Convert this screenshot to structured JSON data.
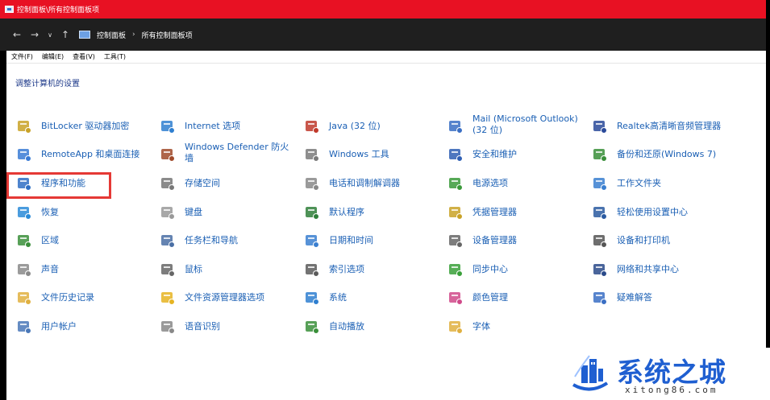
{
  "window": {
    "title": "控制面板\\所有控制面板项"
  },
  "nav": {
    "back": "←",
    "forward": "→",
    "history": "∨",
    "up": "↑",
    "breadcrumb": [
      "控制面板",
      "所有控制面板项"
    ],
    "breadcrumb_sep": "›"
  },
  "menu": [
    "文件(F)",
    "编辑(E)",
    "查看(V)",
    "工具(T)"
  ],
  "heading": "调整计算机的设置",
  "items": [
    {
      "label": "BitLocker 驱动器加密",
      "icon": "bitlocker-icon",
      "color": "#c9a227"
    },
    {
      "label": "RemoteApp 和桌面连接",
      "icon": "remoteapp-icon",
      "color": "#3a7bd5"
    },
    {
      "label": "程序和功能",
      "icon": "programs-icon",
      "color": "#2f6fc4"
    },
    {
      "label": "恢复",
      "icon": "recovery-icon",
      "color": "#2a8bd8"
    },
    {
      "label": "区域",
      "icon": "region-icon",
      "color": "#3b8f3b"
    },
    {
      "label": "声音",
      "icon": "sound-icon",
      "color": "#8a8a8a"
    },
    {
      "label": "文件历史记录",
      "icon": "file-history-icon",
      "color": "#e0b040"
    },
    {
      "label": "用户帐户",
      "icon": "user-accounts-icon",
      "color": "#4a78b8"
    },
    {
      "label": "Internet 选项",
      "icon": "internet-icon",
      "color": "#2f7fd0"
    },
    {
      "label": "Windows Defender 防火墙",
      "icon": "firewall-icon",
      "color": "#a04a2a"
    },
    {
      "label": "存储空间",
      "icon": "storage-icon",
      "color": "#777777"
    },
    {
      "label": "键盘",
      "icon": "keyboard-icon",
      "color": "#999999"
    },
    {
      "label": "任务栏和导航",
      "icon": "taskbar-icon",
      "color": "#4a6fa5"
    },
    {
      "label": "鼠标",
      "icon": "mouse-icon",
      "color": "#666666"
    },
    {
      "label": "文件资源管理器选项",
      "icon": "folder-options-icon",
      "color": "#e6b422"
    },
    {
      "label": "语音识别",
      "icon": "microphone-icon",
      "color": "#888888"
    },
    {
      "label": "Java (32 位)",
      "icon": "java-icon",
      "color": "#c0392b"
    },
    {
      "label": "Windows 工具",
      "icon": "tools-icon",
      "color": "#7a7a7a"
    },
    {
      "label": "电话和调制解调器",
      "icon": "phone-icon",
      "color": "#888888"
    },
    {
      "label": "默认程序",
      "icon": "default-programs-icon",
      "color": "#2f7f3a"
    },
    {
      "label": "日期和时间",
      "icon": "datetime-icon",
      "color": "#3a7fd0"
    },
    {
      "label": "索引选项",
      "icon": "index-icon",
      "color": "#5a5a5a"
    },
    {
      "label": "系统",
      "icon": "system-icon",
      "color": "#2f7fd0"
    },
    {
      "label": "自动播放",
      "icon": "autoplay-icon",
      "color": "#3a8f3a"
    },
    {
      "label": "Mail (Microsoft Outlook)\n(32 位)",
      "icon": "mail-icon",
      "color": "#3a6fc4"
    },
    {
      "label": "安全和维护",
      "icon": "security-flag-icon",
      "color": "#2f5fb4"
    },
    {
      "label": "电源选项",
      "icon": "power-icon",
      "color": "#3a9a3a"
    },
    {
      "label": "凭据管理器",
      "icon": "credential-icon",
      "color": "#c9a227"
    },
    {
      "label": "设备管理器",
      "icon": "device-manager-icon",
      "color": "#666666"
    },
    {
      "label": "同步中心",
      "icon": "sync-icon",
      "color": "#3aa03a"
    },
    {
      "label": "颜色管理",
      "icon": "color-icon",
      "color": "#d04a8a"
    },
    {
      "label": "字体",
      "icon": "font-icon",
      "color": "#e0b040"
    },
    {
      "label": "Realtek高清晰音频管理器",
      "icon": "realtek-icon",
      "color": "#2a4a9a"
    },
    {
      "label": "备份和还原(Windows 7)",
      "icon": "backup-icon",
      "color": "#3a8f3a"
    },
    {
      "label": "工作文件夹",
      "icon": "work-folders-icon",
      "color": "#3a7fd0"
    },
    {
      "label": "轻松使用设置中心",
      "icon": "ease-of-access-icon",
      "color": "#2a5aa0"
    },
    {
      "label": "设备和打印机",
      "icon": "printer-icon",
      "color": "#555555"
    },
    {
      "label": "网络和共享中心",
      "icon": "network-icon",
      "color": "#2a4a8a"
    },
    {
      "label": "疑难解答",
      "icon": "troubleshoot-icon",
      "color": "#3a6fc4"
    }
  ],
  "watermark": {
    "title": "系统之城",
    "url": "xitong86.com"
  }
}
